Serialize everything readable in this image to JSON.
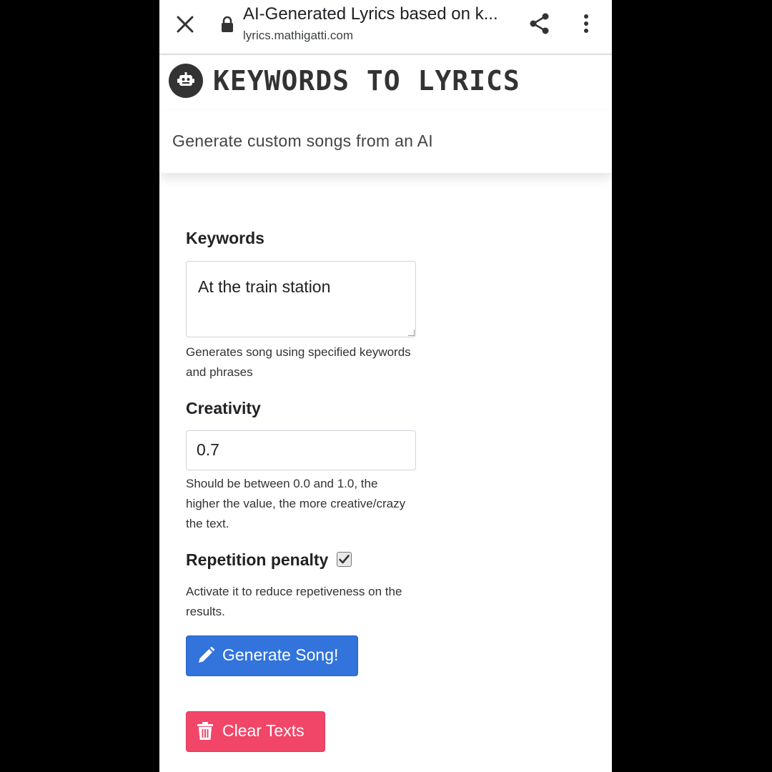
{
  "browser": {
    "page_title": "AI-Generated Lyrics based on k...",
    "url": "lyrics.mathigatti.com"
  },
  "header": {
    "brand": "KEYWORDS TO LYRICS",
    "tagline": "Generate custom songs from an AI"
  },
  "form": {
    "keywords": {
      "label": "Keywords",
      "value": "At the train station",
      "help": "Generates song using specified keywords and phrases"
    },
    "creativity": {
      "label": "Creativity",
      "value": "0.7",
      "help": "Should be between 0.0 and 1.0, the higher the value, the more creative/crazy the text."
    },
    "repetition": {
      "label": "Repetition penalty",
      "checked": true,
      "help": "Activate it to reduce repetiveness on the results."
    },
    "generate_label": "Generate Song!",
    "clear_label": "Clear Texts"
  },
  "colors": {
    "primary": "#3273dc",
    "danger": "#f14668"
  },
  "icons": {
    "close": "close-icon",
    "lock": "lock-icon",
    "share": "share-icon",
    "more": "more-vert-icon",
    "logo": "robot-icon",
    "generate": "pencil-icon",
    "clear": "trash-icon",
    "checkbox": "checkmark-icon"
  }
}
